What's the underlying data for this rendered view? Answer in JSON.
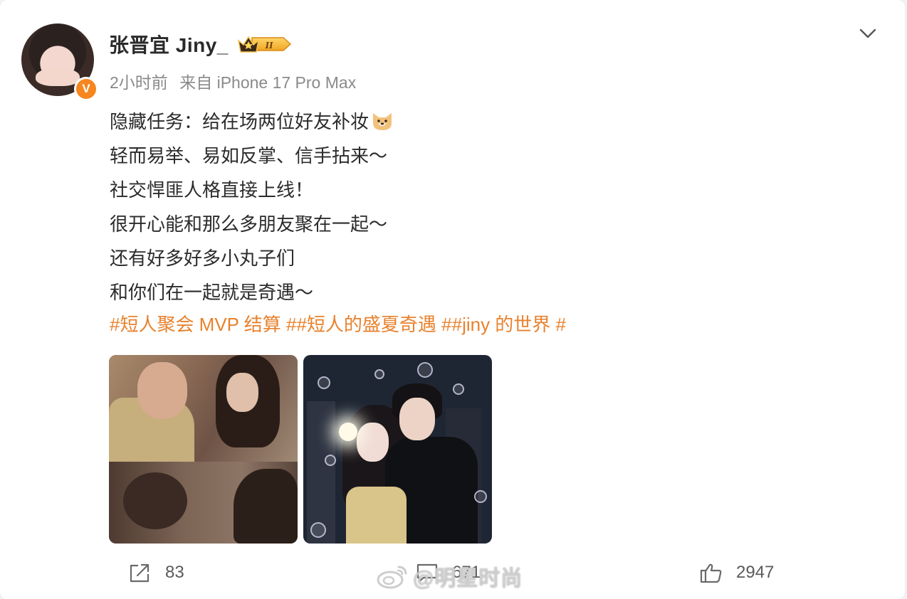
{
  "post": {
    "username": "张晋宜 Jiny_",
    "member_level": "II",
    "verified_badge": "V",
    "time": "2小时前",
    "source": "来自 iPhone 17 Pro Max",
    "lines": [
      "隐藏任务：给在场两位好友补妆",
      "轻而易举、易如反掌、信手拈来～",
      "社交悍匪人格直接上线！",
      "很开心能和那么多朋友聚在一起～",
      "还有好多好多小丸子们",
      "和你们在一起就是奇遇～"
    ],
    "topics": "#短人聚会 MVP 结算 ##短人的盛夏奇遇 ##jiny 的世界 #"
  },
  "actions": {
    "share_count": "83",
    "comment_count": "671",
    "like_count": "2947"
  },
  "watermark": "@明星时尚",
  "colors": {
    "accent_topic": "#e8822e",
    "verified": "#f6861f"
  }
}
